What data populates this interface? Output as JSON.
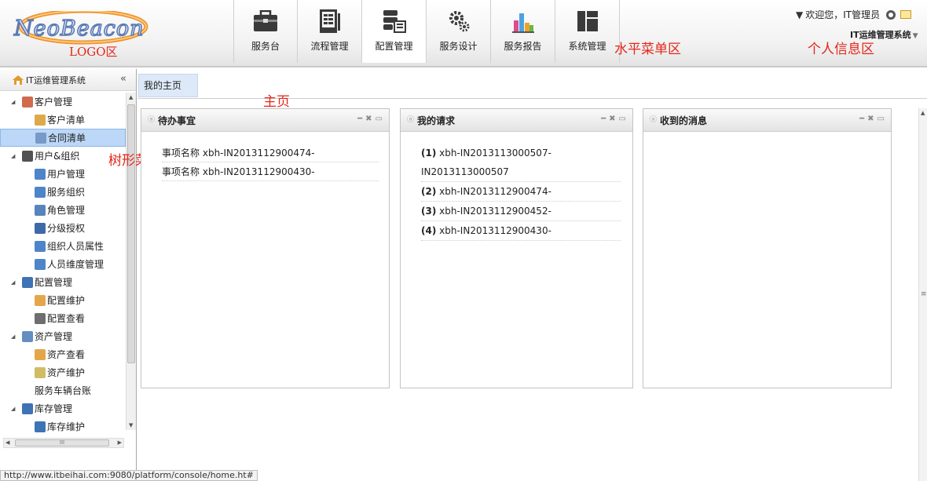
{
  "header": {
    "logo_text": "NeoBeacon",
    "logo_area_label": "LOGO区",
    "nav_area_label": "水平菜单区",
    "user_area_label": "个人信息区",
    "welcome": "欢迎您，IT管理员",
    "system_name": "IT运维管理系统",
    "nav": [
      {
        "label": "服务台",
        "icon": "briefcase-icon"
      },
      {
        "label": "流程管理",
        "icon": "document-list-icon"
      },
      {
        "label": "配置管理",
        "icon": "database-config-icon",
        "active": true
      },
      {
        "label": "服务设计",
        "icon": "gears-icon"
      },
      {
        "label": "服务报告",
        "icon": "bar-chart-icon"
      },
      {
        "label": "系统管理",
        "icon": "system-blocks-icon"
      }
    ]
  },
  "sidebar": {
    "title": "IT运维管理系统",
    "collapse": "«",
    "tree_area_label": "树形菜单区",
    "tree": [
      {
        "label": "客户管理",
        "level": 0
      },
      {
        "label": "客户清单",
        "level": 1
      },
      {
        "label": "合同清单",
        "level": 1,
        "selected": true
      },
      {
        "label": "用户&组织",
        "level": 0
      },
      {
        "label": "用户管理",
        "level": 1
      },
      {
        "label": "服务组织",
        "level": 1
      },
      {
        "label": "角色管理",
        "level": 1
      },
      {
        "label": "分级授权",
        "level": 1
      },
      {
        "label": "组织人员属性",
        "level": 1
      },
      {
        "label": "人员维度管理",
        "level": 1
      },
      {
        "label": "配置管理",
        "level": 0
      },
      {
        "label": "配置维护",
        "level": 1
      },
      {
        "label": "配置查看",
        "level": 1
      },
      {
        "label": "资产管理",
        "level": 0
      },
      {
        "label": "资产查看",
        "level": 1
      },
      {
        "label": "资产维护",
        "level": 1
      },
      {
        "label": "服务车辆台账",
        "level": 1
      },
      {
        "label": "库存管理",
        "level": 0
      },
      {
        "label": "库存维护",
        "level": 1
      }
    ],
    "hscroll_grip": "III"
  },
  "main": {
    "tab": "我的主页",
    "home_area_label": "主页",
    "panels": {
      "todo": {
        "title": "待办事宜",
        "items": [
          {
            "prefix": "事项名称",
            "id": "xbh-IN2013112900474-"
          },
          {
            "prefix": "事项名称",
            "id": "xbh-IN2013112900430-"
          }
        ]
      },
      "requests": {
        "title": "我的请求",
        "items": [
          {
            "num": "(1)",
            "id": "xbh-IN2013113000507-",
            "cont": "IN2013113000507"
          },
          {
            "num": "(2)",
            "id": "xbh-IN2013112900474-"
          },
          {
            "num": "(3)",
            "id": "xbh-IN2013112900452-"
          },
          {
            "num": "(4)",
            "id": "xbh-IN2013112900430-"
          }
        ]
      },
      "messages": {
        "title": "收到的消息"
      }
    },
    "panel_tools": {
      "minimize": "━",
      "close": "✖",
      "open": "▭"
    }
  },
  "statusbar": {
    "url": "http://www.itbeihai.com:9080/platform/console/home.ht#"
  },
  "colors": {
    "annotation": "#e4261a",
    "selected": "#bcd7f7",
    "tab": "#dde9f8"
  }
}
